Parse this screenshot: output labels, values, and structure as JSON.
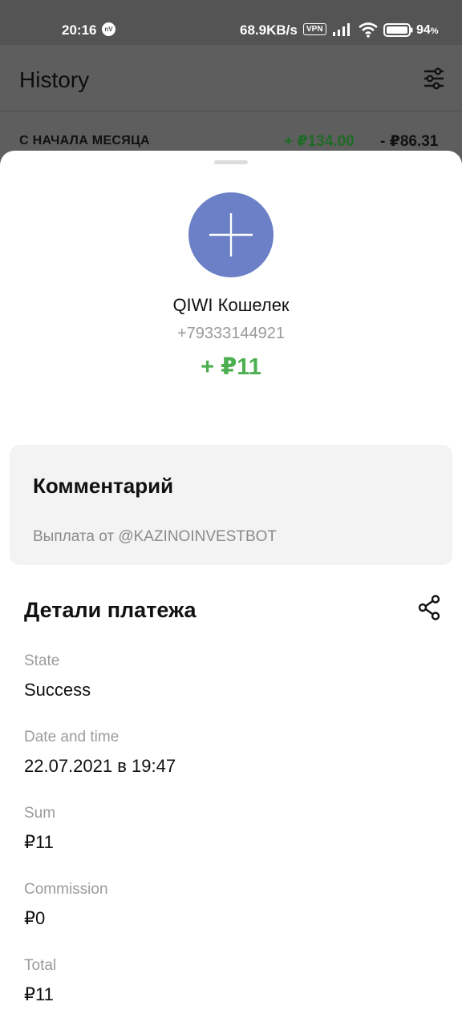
{
  "status_bar": {
    "time": "20:16",
    "notification_icon": "nV",
    "network_speed": "68.9KB/s",
    "vpn_label": "VPN",
    "battery_percent": "94",
    "battery_unit": "%"
  },
  "app_bar": {
    "title": "History",
    "filter_icon": "sliders-icon"
  },
  "summary": {
    "label": "С НАЧАЛА МЕСЯЦА",
    "income": "+ ₽134.00",
    "expense": "- ₽86.31"
  },
  "transaction": {
    "avatar_icon": "plus-icon",
    "merchant": "QIWI Кошелек",
    "phone": "+79333144921",
    "amount": "+ ₽11"
  },
  "comment": {
    "title": "Комментарий",
    "text": "Выплата от @KAZINOINVESTBOT"
  },
  "details": {
    "title": "Детали платежа",
    "share_icon": "share-icon",
    "fields": [
      {
        "label": "State",
        "value": "Success"
      },
      {
        "label": "Date and time",
        "value": "22.07.2021 в 19:47"
      },
      {
        "label": "Sum",
        "value": "₽11"
      },
      {
        "label": "Commission",
        "value": "₽0"
      },
      {
        "label": "Total",
        "value": "₽11"
      }
    ]
  },
  "colors": {
    "income_green": "#4caf50",
    "avatar_blue": "#6b80c6",
    "card_gray": "#f3f3f3"
  }
}
